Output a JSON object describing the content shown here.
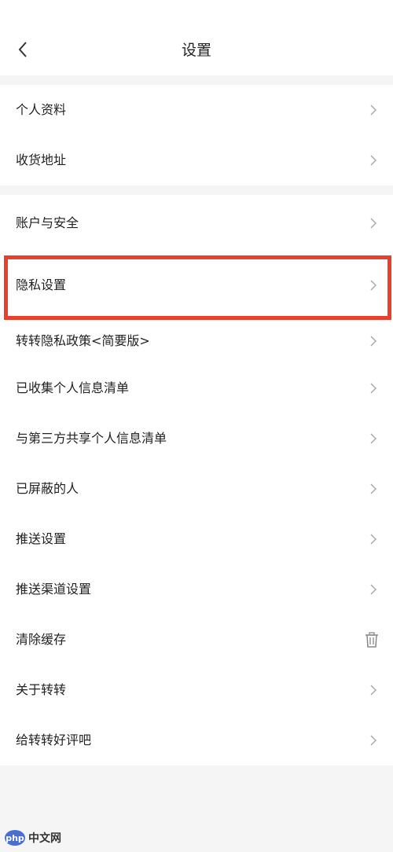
{
  "header": {
    "title": "设置",
    "back_icon": "chevron-left-icon"
  },
  "group1": [
    {
      "label": "个人资料",
      "icon": "chevron-right-icon"
    },
    {
      "label": "收货地址",
      "icon": "chevron-right-icon"
    }
  ],
  "group2": [
    {
      "label": "账户与安全",
      "icon": "chevron-right-icon"
    },
    {
      "label": "隐私设置",
      "icon": "chevron-right-icon"
    },
    {
      "label": "转转隐私政策<简要版>",
      "icon": "chevron-right-icon"
    },
    {
      "label": "已收集个人信息清单",
      "icon": "chevron-right-icon"
    },
    {
      "label": "与第三方共享个人信息清单",
      "icon": "chevron-right-icon"
    },
    {
      "label": "已屏蔽的人",
      "icon": "chevron-right-icon"
    },
    {
      "label": "推送设置",
      "icon": "chevron-right-icon"
    },
    {
      "label": "推送渠道设置",
      "icon": "chevron-right-icon"
    },
    {
      "label": "清除缓存",
      "icon": "trash-icon"
    },
    {
      "label": "关于转转",
      "icon": "chevron-right-icon"
    },
    {
      "label": "给转转好评吧",
      "icon": "chevron-right-icon"
    }
  ],
  "highlight_color": "#e8402a",
  "watermark": {
    "logo": "php",
    "text": "中文网"
  }
}
